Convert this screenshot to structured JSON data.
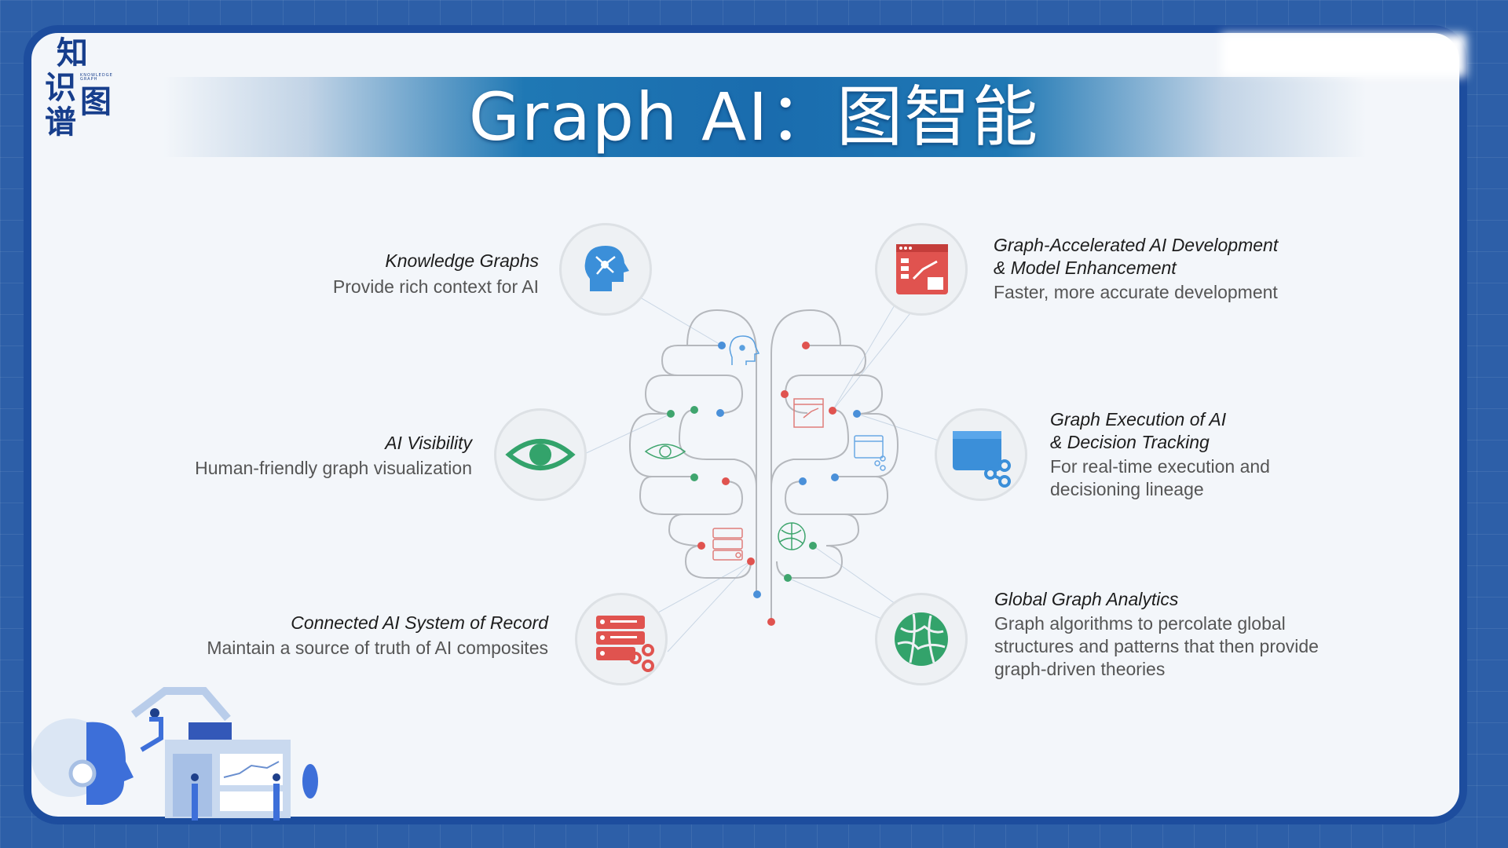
{
  "logo": {
    "chars": [
      "知",
      "识",
      "谱",
      "图"
    ],
    "subtext": "KNOWLEDGE GRAPH"
  },
  "title": "Graph AI：图智能",
  "features": [
    {
      "title": "Knowledge Graphs",
      "desc": [
        "Provide rich context for AI"
      ],
      "icon": "brain-head-network-icon",
      "color": "#3b8fd9"
    },
    {
      "title": "Graph-Accelerated AI Development",
      "title2": "& Model Enhancement",
      "desc": [
        "Faster, more accurate development"
      ],
      "icon": "dashboard-chart-icon",
      "color": "#e0534f"
    },
    {
      "title": "AI Visibility",
      "desc": [
        "Human-friendly graph visualization"
      ],
      "icon": "eye-icon",
      "color": "#33a36b"
    },
    {
      "title": "Graph Execution of AI",
      "title2": "& Decision Tracking",
      "desc": [
        "For real-time execution and",
        "decisioning lineage"
      ],
      "icon": "browser-share-icon",
      "color": "#3b8fd9"
    },
    {
      "title": "Connected AI System of Record",
      "desc": [
        "Maintain a source of truth of AI composites"
      ],
      "icon": "server-share-icon",
      "color": "#e0534f"
    },
    {
      "title": "Global Graph Analytics",
      "desc": [
        "Graph algorithms to percolate global",
        "structures and patterns that then provide",
        "graph-driven theories"
      ],
      "icon": "globe-network-icon",
      "color": "#33a36b"
    }
  ]
}
